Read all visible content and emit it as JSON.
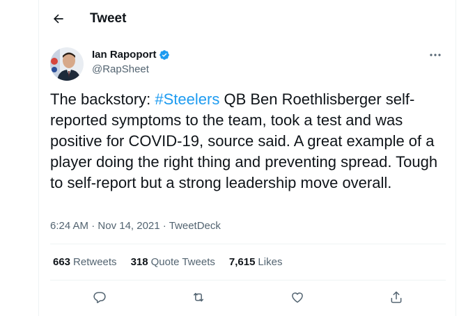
{
  "header": {
    "title": "Tweet"
  },
  "author": {
    "name": "Ian Rapoport",
    "handle": "@RapSheet",
    "verified": true
  },
  "tweet": {
    "text_before": "The backstory: ",
    "hashtag": "#Steelers",
    "text_after": " QB Ben Roethlisberger self-reported symptoms to the team, took a test and was positive for COVID-19, source said. A great example of a player doing the right thing and preventing spread. Tough to self-report but a strong leadership move overall."
  },
  "meta": {
    "time": "6:24 AM",
    "separator": " · ",
    "date": "Nov 14, 2021",
    "source": "TweetDeck"
  },
  "stats": {
    "retweets": {
      "count": "663",
      "label": "Retweets"
    },
    "quotes": {
      "count": "318",
      "label": "Quote Tweets"
    },
    "likes": {
      "count": "7,615",
      "label": "Likes"
    }
  },
  "colors": {
    "accent": "#1d9bf0",
    "secondary_text": "#536471",
    "divider": "#eff3f4"
  },
  "icons": [
    "back-arrow-icon",
    "verified-badge-icon",
    "more-icon",
    "reply-icon",
    "retweet-icon",
    "like-icon",
    "share-icon"
  ]
}
